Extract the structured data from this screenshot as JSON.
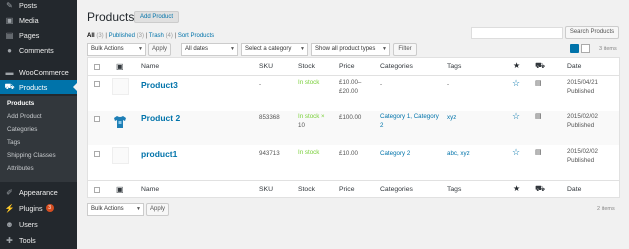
{
  "sidebar": {
    "items": [
      {
        "label": "Posts",
        "icon": "pin-icon"
      },
      {
        "label": "Media",
        "icon": "media-icon"
      },
      {
        "label": "Pages",
        "icon": "pages-icon"
      },
      {
        "label": "Comments",
        "icon": "comments-icon"
      },
      {
        "label": "WooCommerce",
        "icon": "woocommerce-icon"
      },
      {
        "label": "Products",
        "icon": "products-icon"
      },
      {
        "label": "Appearance",
        "icon": "appearance-icon"
      },
      {
        "label": "Plugins",
        "icon": "plugins-icon",
        "badge": "3"
      },
      {
        "label": "Users",
        "icon": "users-icon"
      },
      {
        "label": "Tools",
        "icon": "tools-icon"
      }
    ],
    "submenu": [
      "Products",
      "Add Product",
      "Categories",
      "Tags",
      "Shipping Classes",
      "Attributes"
    ]
  },
  "header": {
    "title": "Products",
    "add_new": "Add Product"
  },
  "filters": {
    "all": "All",
    "all_count": "(3)",
    "published": "Published",
    "published_count": "(3)",
    "trash": "Trash",
    "trash_count": "(4)",
    "sort": "Sort Products",
    "sep": "|"
  },
  "search": {
    "placeholder": "",
    "button": "Search Products"
  },
  "toolbar": {
    "bulk_actions": "Bulk Actions",
    "apply": "Apply",
    "all_dates": "All dates",
    "category": "Select a category",
    "product_type": "Show all product types",
    "filter": "Filter",
    "items_count": "3 items",
    "bottom_items_count": "2 items"
  },
  "table": {
    "columns": [
      "Name",
      "SKU",
      "Stock",
      "Price",
      "Categories",
      "Tags",
      "Date"
    ],
    "rows": [
      {
        "name": "Product3",
        "sku": "-",
        "stock": "In stock",
        "stock_extra": "",
        "price_lines": [
          "£10.00–",
          "£20.00"
        ],
        "categories": [
          "-"
        ],
        "tags": "-",
        "date": "2015/04/21",
        "status": "Published"
      },
      {
        "name": "Product 2",
        "sku": "853368",
        "stock": "In stock ×",
        "stock_extra": "10",
        "price_lines": [
          "£100.00",
          ""
        ],
        "categories": [
          "Category 1, Category",
          "2"
        ],
        "tags": "xyz",
        "date": "2015/02/02",
        "status": "Published"
      },
      {
        "name": "product1",
        "sku": "943713",
        "stock": "In stock",
        "stock_extra": "",
        "price_lines": [
          "£10.00",
          ""
        ],
        "categories": [
          "Category 2"
        ],
        "tags": "abc, xyz",
        "date": "2015/02/02",
        "status": "Published"
      }
    ]
  },
  "colors": {
    "accent": "#0073aa",
    "sidebar": "#23282d",
    "instock": "#7ad03a"
  }
}
